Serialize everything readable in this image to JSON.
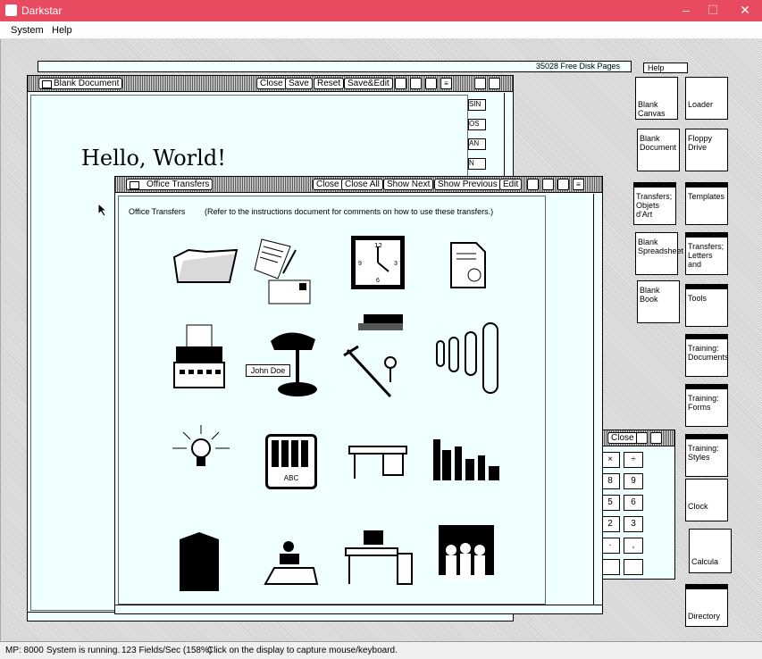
{
  "app": {
    "title": "Darkstar"
  },
  "menu": [
    "System",
    "Help"
  ],
  "topbar": {
    "disk": "35028 Free Disk Pages",
    "help": "Help"
  },
  "blank_doc": {
    "title": "Blank Document",
    "buttons": [
      "Close",
      "Save",
      "Reset",
      "Save&Edit"
    ],
    "content": "Hello, World!"
  },
  "transfers": {
    "title": "Office Transfers",
    "buttons": [
      "Close",
      "Close All",
      "Show Next",
      "Show Previous",
      "Edit"
    ],
    "intro_label": "Office Transfers",
    "intro_text": "(Refer to the instructions document for comments on how to use these transfers.)",
    "nameplate": "John Doe",
    "tray_label": "ABC"
  },
  "calc": {
    "close": "Close",
    "keys": [
      "×",
      "÷",
      "8",
      "9",
      "5",
      "6",
      "2",
      "3",
      "·",
      ",",
      "",
      ""
    ]
  },
  "partial_buttons": [
    "SIN",
    "OS",
    "AN",
    "N"
  ],
  "icons": [
    {
      "label": "Blank Canvas",
      "name": "blank-canvas-icon"
    },
    {
      "label": "Loader",
      "name": "loader-icon"
    },
    {
      "label": "Blank Document",
      "name": "blank-document-icon"
    },
    {
      "label": "Floppy Drive",
      "name": "floppy-drive-icon"
    },
    {
      "label": "Transfers; Objets d'Art",
      "name": "transfers-objets-icon"
    },
    {
      "label": "Templates",
      "name": "templates-icon"
    },
    {
      "label": "Blank Spreadsheet",
      "name": "blank-spreadsheet-icon"
    },
    {
      "label": "Transfers; Letters and",
      "name": "transfers-letters-icon"
    },
    {
      "label": "Blank Book",
      "name": "blank-book-icon"
    },
    {
      "label": "Tools",
      "name": "tools-icon"
    },
    {
      "label": "Training: Documents",
      "name": "training-documents-icon"
    },
    {
      "label": "Training: Forms",
      "name": "training-forms-icon"
    },
    {
      "label": "Training: Styles",
      "name": "training-styles-icon"
    },
    {
      "label": "Clock",
      "name": "clock-icon"
    },
    {
      "label": "Calcula",
      "name": "calculator-icon"
    },
    {
      "label": "Directory",
      "name": "directory-icon"
    }
  ],
  "status": {
    "mp": "MP: 8000",
    "state": "System is running.",
    "fields": "123 Fields/Sec (158%)",
    "hint": "Click on the display to capture mouse/keyboard."
  }
}
